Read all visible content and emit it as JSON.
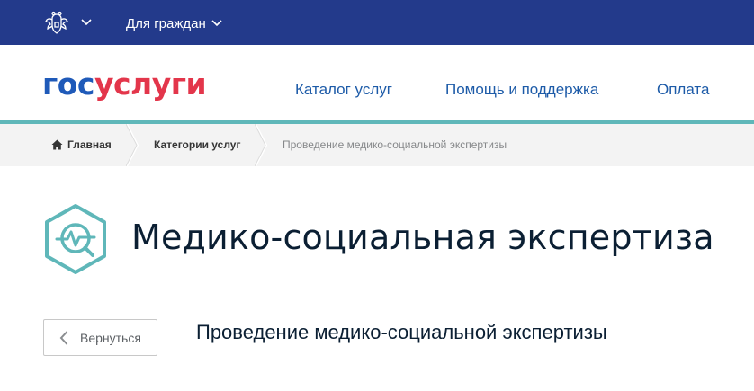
{
  "topbar": {
    "for_citizens_label": "Для граждан"
  },
  "header": {
    "logo": {
      "part1": "гос",
      "part2": "услуги"
    },
    "nav": [
      {
        "label": "Каталог услуг"
      },
      {
        "label": "Помощь и поддержка"
      },
      {
        "label": "Оплата"
      }
    ]
  },
  "breadcrumbs": [
    {
      "label": "Главная"
    },
    {
      "label": "Категории услуг"
    },
    {
      "label": "Проведение медико-социальной экспертизы"
    }
  ],
  "page": {
    "title": "Медико-социальная экспертиза",
    "back_label": "Вернуться",
    "service_title": "Проведение медико-социальной экспертизы"
  },
  "colors": {
    "topbar": "#233a8b",
    "logo_blue": "#1f5ab9",
    "logo_red": "#e3364b",
    "nav_link": "#1d5ba8",
    "accent_line": "#5fb7b9",
    "breadcrumb_bg": "#f3f3f3"
  },
  "icons": [
    "emblem-icon",
    "chevron-down-icon",
    "home-icon",
    "medical-expertise-icon",
    "chevron-left-icon"
  ]
}
